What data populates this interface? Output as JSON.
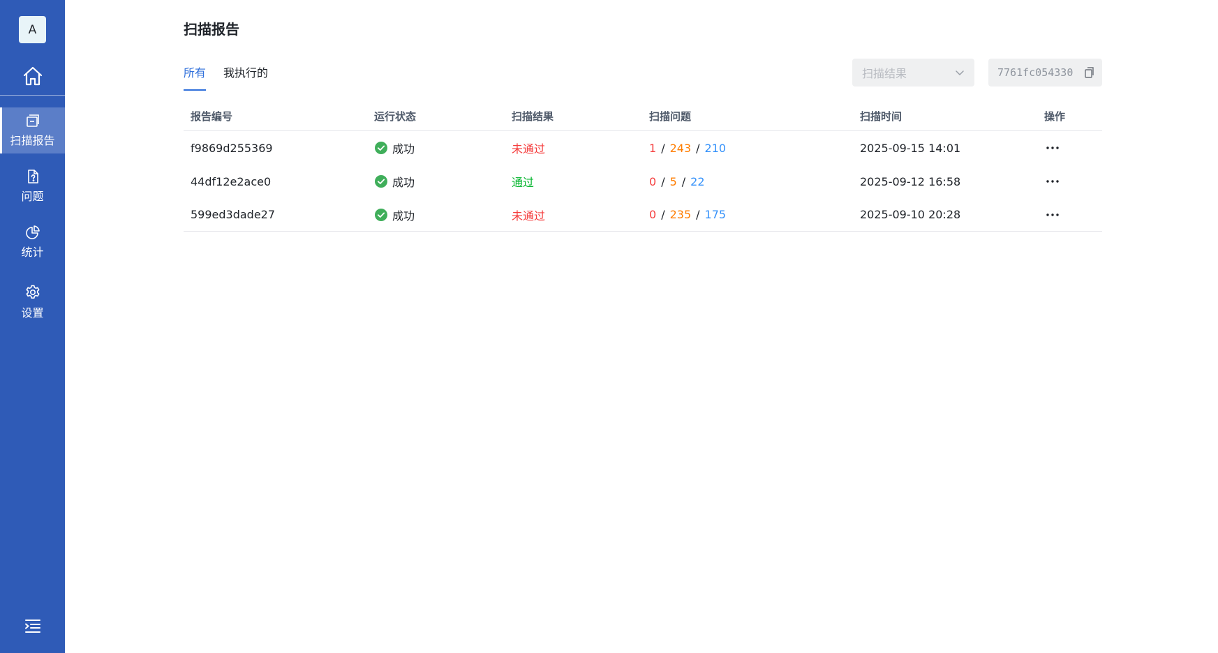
{
  "sidebar": {
    "avatar_letter": "A",
    "items": [
      {
        "label": "扫描报告",
        "active": true
      },
      {
        "label": "问题",
        "active": false
      },
      {
        "label": "统计",
        "active": false
      },
      {
        "label": "设置",
        "active": false
      }
    ]
  },
  "page": {
    "title": "扫描报告"
  },
  "tabs": [
    {
      "label": "所有",
      "active": true
    },
    {
      "label": "我执行的",
      "active": false
    }
  ],
  "filters": {
    "result_placeholder": "扫描结果",
    "commit_hash": "7761fc054330"
  },
  "table": {
    "headers": {
      "id": "报告编号",
      "status": "运行状态",
      "result": "扫描结果",
      "issues": "扫描问题",
      "time": "扫描时间",
      "ops": "操作"
    },
    "rows": [
      {
        "id": "f9869d255369",
        "status": "成功",
        "result": "未通过",
        "issues": {
          "a": "1",
          "b": "243",
          "c": "210"
        },
        "time": "2025-09-15 14:01"
      },
      {
        "id": "44df12e2ace0",
        "status": "成功",
        "result": "通过",
        "issues": {
          "a": "0",
          "b": "5",
          "c": "22"
        },
        "time": "2025-09-12 16:58"
      },
      {
        "id": "599ed3dade27",
        "status": "成功",
        "result": "未通过",
        "issues": {
          "a": "0",
          "b": "235",
          "c": "175"
        },
        "time": "2025-09-10 20:28"
      }
    ]
  },
  "colors": {
    "sidebar_bg": "#2f5bb7",
    "accent": "#2f6fdb",
    "fail": "#f53f3f",
    "pass": "#00b42a",
    "issue_high": "#f53f3f",
    "issue_mid": "#ff7d00",
    "issue_low": "#3491fa"
  }
}
